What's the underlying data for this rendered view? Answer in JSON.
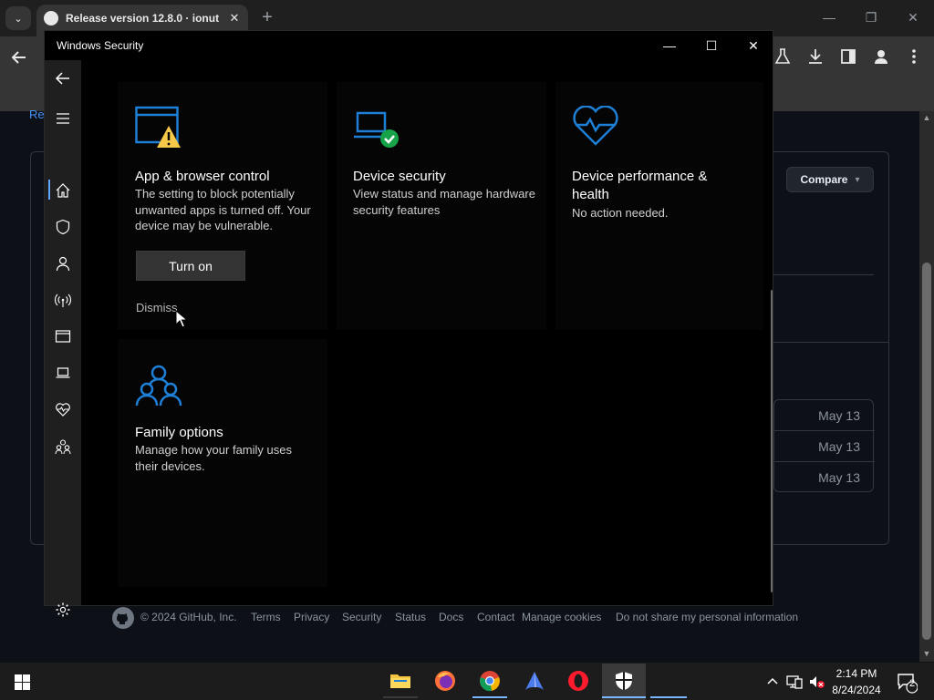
{
  "browser": {
    "tab_title": "Release version 12.8.0 · ionutt",
    "tab_close": "✕",
    "new_tab": "+",
    "menu_caret": "⌄",
    "win_minimize": "—",
    "win_restore": "❐",
    "win_close": "✕"
  },
  "github": {
    "partial_link": "Re",
    "compare_label": "Compare",
    "compare_caret": "▾",
    "release_dates": [
      "May 13",
      "May 13",
      "May 13"
    ],
    "footer_copyright": "© 2024 GitHub, Inc.",
    "footer_links": [
      "Terms",
      "Privacy",
      "Security",
      "Status",
      "Docs",
      "Contact",
      "Manage cookies",
      "Do not share my personal information"
    ]
  },
  "windows_security": {
    "title": "Windows Security",
    "minimize": "—",
    "maximize": "☐",
    "close": "✕",
    "nav_items": [
      "back",
      "menu",
      "home",
      "virus-protection",
      "account-protection",
      "firewall-network",
      "app-browser-control",
      "device-security",
      "device-performance",
      "family-options",
      "settings"
    ],
    "tiles": [
      {
        "title": "App & browser control",
        "description": "The setting to block potentially unwanted apps is turned off. Your device may be vulnerable.",
        "action_label": "Turn on",
        "dismiss_label": "Dismiss",
        "status": "warning",
        "icon": "app-browser-warning-icon"
      },
      {
        "title": "Device security",
        "description": "View status and manage hardware security features",
        "status": "ok",
        "icon": "laptop-check-icon"
      },
      {
        "title": "Device performance & health",
        "description": "No action needed.",
        "status": "ok",
        "icon": "heart-pulse-icon"
      },
      {
        "title": "Family options",
        "description": "Manage how your family uses their devices.",
        "icon": "family-icon"
      }
    ]
  },
  "taskbar": {
    "time": "2:14 PM",
    "date": "8/24/2024",
    "notification_count": "2",
    "apps": [
      "file-explorer-icon",
      "firefox-icon",
      "chrome-icon",
      "app-icon",
      "opera-icon",
      "windows-security-icon",
      "blank-app"
    ]
  },
  "colors": {
    "accent_blue": "#1e7fd6",
    "warning_yellow": "#f7c948",
    "ok_green": "#16a34a",
    "github_link": "#4493f8"
  }
}
